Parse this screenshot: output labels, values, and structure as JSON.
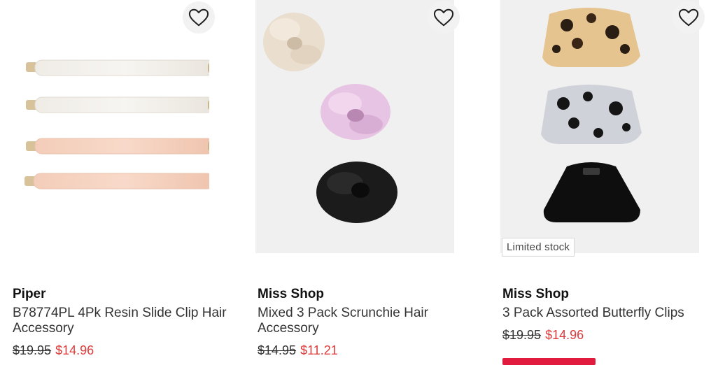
{
  "products": [
    {
      "brand": "Piper",
      "name": "B78774PL 4Pk Resin Slide Clip Hair Accessory",
      "old_price": "$19.95",
      "sale_price": "$14.96",
      "icon": "heart-outline-icon"
    },
    {
      "brand": "Miss Shop",
      "name": "Mixed 3 Pack Scrunchie Hair Accessory",
      "old_price": "$14.95",
      "sale_price": "$11.21",
      "icon": "heart-outline-icon"
    },
    {
      "brand": "Miss Shop",
      "name": "3 Pack Assorted Butterfly Clips",
      "old_price": "$19.95",
      "sale_price": "$14.96",
      "badge": "Limited stock",
      "icon": "heart-outline-icon"
    }
  ],
  "colors": {
    "sale": "#e03a3a",
    "cart_button": "#e11b3d",
    "image_bg": "#f0f0f0"
  }
}
